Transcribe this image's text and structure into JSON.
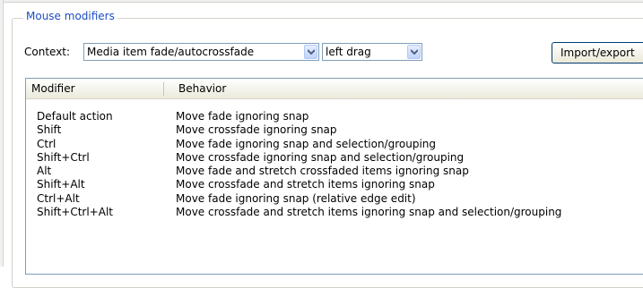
{
  "group": {
    "title": "Mouse modifiers"
  },
  "context": {
    "label": "Context:",
    "selected": "Media item fade/autocrossfade",
    "action_selected": "left drag"
  },
  "buttons": {
    "import_export": "Import/export"
  },
  "table": {
    "columns": [
      "Modifier",
      "Behavior"
    ],
    "rows": [
      {
        "modifier": "Default action",
        "behavior": "Move fade ignoring snap"
      },
      {
        "modifier": "Shift",
        "behavior": "Move crossfade ignoring snap"
      },
      {
        "modifier": "Ctrl",
        "behavior": "Move fade ignoring snap and selection/grouping"
      },
      {
        "modifier": "Shift+Ctrl",
        "behavior": "Move crossfade ignoring snap and selection/grouping"
      },
      {
        "modifier": "Alt",
        "behavior": "Move fade and stretch crossfaded items ignoring snap"
      },
      {
        "modifier": "Shift+Alt",
        "behavior": "Move crossfade and stretch items ignoring snap"
      },
      {
        "modifier": "Ctrl+Alt",
        "behavior": "Move fade ignoring snap (relative edge edit)"
      },
      {
        "modifier": "Shift+Ctrl+Alt",
        "behavior": "Move crossfade and stretch items ignoring snap and selection/grouping"
      }
    ]
  },
  "colors": {
    "group_title": "#1c4ec4",
    "combo_border": "#7f9db9",
    "button_border": "#003c74"
  },
  "icons": {
    "dropdown": "chevron-down-icon"
  }
}
